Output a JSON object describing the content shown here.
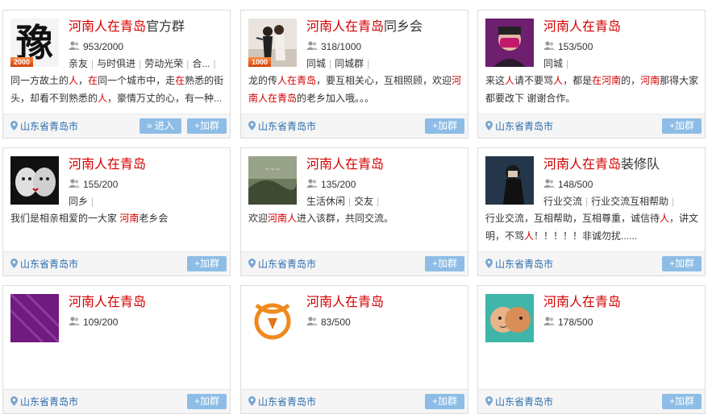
{
  "location_label": "山东省青岛市",
  "join_label": "+加群",
  "enter_label": "» 进入",
  "cards": [
    {
      "title_hl": "河南人在青岛",
      "title_rest": "官方群",
      "count": "953/2000",
      "badge": "2000",
      "tags": [
        "亲友",
        "与时俱进",
        "劳动光荣",
        "合..."
      ],
      "desc_parts": [
        [
          "同一方故土的",
          false
        ],
        [
          "人",
          true
        ],
        [
          "，",
          false
        ],
        [
          "在",
          true
        ],
        [
          "同一个城市中，走",
          false
        ],
        [
          "在",
          true
        ],
        [
          "熟悉的街头，却看不到熟悉的",
          false
        ],
        [
          "人",
          true
        ],
        [
          "，豪情万丈的心，有一种...",
          false
        ]
      ],
      "avatar": "calligraphy",
      "avatar_text": "豫"
    },
    {
      "title_hl": "河南人在青岛",
      "title_rest": "同乡会",
      "count": "318/1000",
      "badge": "1000",
      "tags": [
        "同城",
        "同城群"
      ],
      "desc_parts": [
        [
          "龙的传",
          false
        ],
        [
          "人在青岛",
          true
        ],
        [
          "，要互相关心，互相照顾，欢迎",
          false
        ],
        [
          "河南人在青岛",
          true
        ],
        [
          "的老乡加入哦。。。",
          false
        ]
      ],
      "avatar": "photo-girls"
    },
    {
      "title_hl": "河南人在青岛",
      "title_rest": "",
      "count": "153/500",
      "badge": "",
      "tags": [
        "同城"
      ],
      "desc_parts": [
        [
          "来这",
          false
        ],
        [
          "人",
          true
        ],
        [
          "请不要骂",
          false
        ],
        [
          "人",
          true
        ],
        [
          "，都是",
          false
        ],
        [
          "在河南",
          true
        ],
        [
          "的，",
          false
        ],
        [
          "河南",
          true
        ],
        [
          "那得大家都要改下 谢谢合作。",
          false
        ]
      ],
      "avatar": "photo-mask"
    },
    {
      "title_hl": "河南人在青岛",
      "title_rest": "",
      "count": "155/200",
      "badge": "",
      "tags": [
        "同乡"
      ],
      "desc_parts": [
        [
          "我们是相亲相爱的一大家 ",
          false
        ],
        [
          "河南",
          true
        ],
        [
          "老乡会",
          false
        ]
      ],
      "avatar": "cups"
    },
    {
      "title_hl": "河南人在青岛",
      "title_rest": "",
      "count": "135/200",
      "badge": "",
      "tags": [
        "生活休闲",
        "交友"
      ],
      "desc_parts": [
        [
          "欢迎",
          false
        ],
        [
          "河南人",
          true
        ],
        [
          "进入该群，共同交流。",
          false
        ]
      ],
      "avatar": "landscape"
    },
    {
      "title_hl": "河南人在青岛",
      "title_rest": "装修队",
      "count": "148/500",
      "badge": "",
      "tags": [
        "行业交流",
        "行业交流互相帮助"
      ],
      "desc_parts": [
        [
          "行业交流，互相帮助，互相尊重，诚信待",
          false
        ],
        [
          "人",
          true
        ],
        [
          "，讲文明，不骂",
          false
        ],
        [
          "人",
          true
        ],
        [
          "！！！！！非诚勿扰......",
          false
        ]
      ],
      "avatar": "photo-dark"
    },
    {
      "title_hl": "河南人在青岛",
      "title_rest": "",
      "count": "109/200",
      "badge": "",
      "tags": [],
      "desc_parts": [],
      "avatar": "purple"
    },
    {
      "title_hl": "河南人在青岛",
      "title_rest": "",
      "count": "83/500",
      "badge": "",
      "tags": [],
      "desc_parts": [],
      "avatar": "orange-logo"
    },
    {
      "title_hl": "河南人在青岛",
      "title_rest": "",
      "count": "178/500",
      "badge": "",
      "tags": [],
      "desc_parts": [],
      "avatar": "faces"
    }
  ]
}
